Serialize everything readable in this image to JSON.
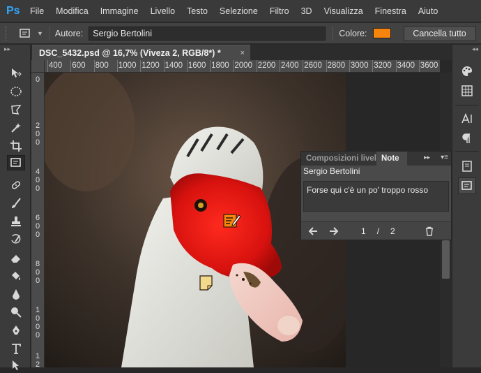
{
  "app": {
    "logo": "Ps",
    "menu": [
      "File",
      "Modifica",
      "Immagine",
      "Livello",
      "Testo",
      "Selezione",
      "Filtro",
      "3D",
      "Visualizza",
      "Finestra",
      "Aiuto"
    ]
  },
  "options": {
    "tool_icon": "note-tool-icon",
    "author_label": "Autore:",
    "author_value": "Sergio Bertolini",
    "color_label": "Colore:",
    "note_color": "#f6840d",
    "clear_button": "Cancella tutto"
  },
  "document": {
    "tab_title": "DSC_5432.psd @ 16,7% (Viveza 2, RGB/8*) *",
    "close_glyph": "×"
  },
  "ruler": {
    "horizontal": [
      "400",
      "600",
      "800",
      "1000",
      "1200",
      "1400",
      "1600",
      "1800",
      "2000",
      "2200",
      "2400",
      "2600",
      "2800",
      "3000",
      "3200",
      "3400",
      "3600"
    ],
    "vertical": [
      {
        "label": "0"
      },
      {
        "label": "200"
      },
      {
        "label": "400"
      },
      {
        "label": "600"
      },
      {
        "label": "800"
      },
      {
        "label": "1000"
      },
      {
        "label": "1200"
      }
    ]
  },
  "notes_panel": {
    "tab_inactive": "Composizioni livelli",
    "tab_active": "Note",
    "collapse_glyph": "▸▸",
    "menu_glyph": "▾≡",
    "author": "Sergio Bertolini",
    "note_text": "Forse qui c'è un po' troppo rosso",
    "page_current": "1",
    "page_sep": "/",
    "page_total": "2"
  },
  "colors": {
    "accent": "#31a8ff",
    "note_orange": "#f6840d",
    "note_yellow": "#f3d98b"
  }
}
